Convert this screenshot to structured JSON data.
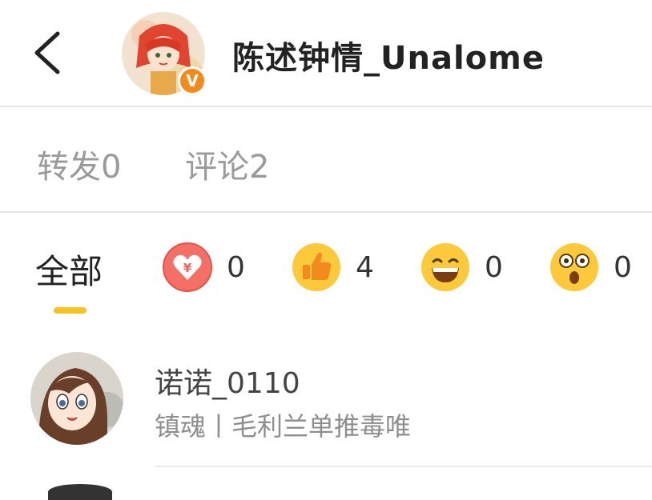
{
  "header": {
    "title": "陈述钟情_Unalome",
    "verified_badge": "V",
    "back_icon": "chevron-left-icon"
  },
  "tabs": [
    {
      "label": "转发",
      "count": "0"
    },
    {
      "label": "评论",
      "count": "2"
    }
  ],
  "reactions": {
    "all_label": "全部",
    "items": [
      {
        "icon": "heart-yen-icon",
        "count": "0"
      },
      {
        "icon": "thumbs-up-icon",
        "count": "4"
      },
      {
        "icon": "laugh-icon",
        "count": "0"
      },
      {
        "icon": "surprised-icon",
        "count": "0"
      }
    ]
  },
  "list": [
    {
      "name": "诺诺_0110",
      "desc": "镇魂丨毛利兰单推毒唯"
    }
  ],
  "colors": {
    "accent": "#f7c223",
    "badge": "#f38b1c",
    "muted": "#9a9a9a"
  }
}
